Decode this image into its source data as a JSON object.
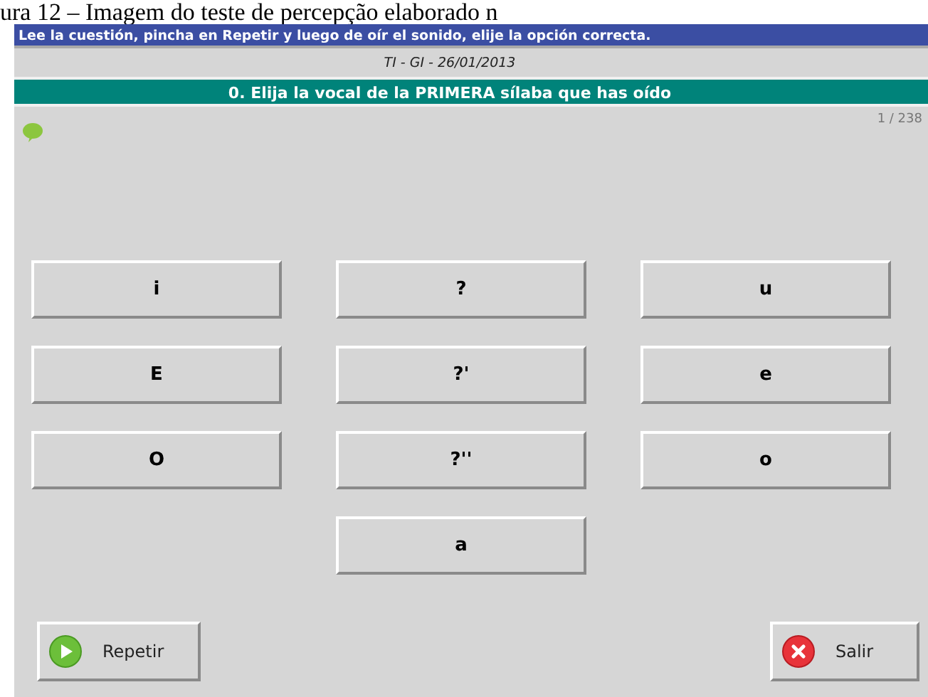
{
  "caption": "ura 12 – Imagem do teste de percepção elaborado n",
  "instruction": "Lee la cuestión, pincha en Repetir y luego de oír el sonido, elije la opción correcta.",
  "test_name": "TI - GI - 26/01/2013",
  "question": "0. Elija la vocal de la PRIMERA sílaba que has oído",
  "counter": "1 / 238",
  "option_columns": [
    [
      "i",
      "E",
      "O"
    ],
    [
      "?",
      "?'",
      "?''",
      "a"
    ],
    [
      "u",
      "e",
      "o"
    ]
  ],
  "buttons": [
    {
      "kind": "repeat",
      "label": "Repetir"
    },
    {
      "kind": "exit",
      "label": "Salir"
    }
  ]
}
